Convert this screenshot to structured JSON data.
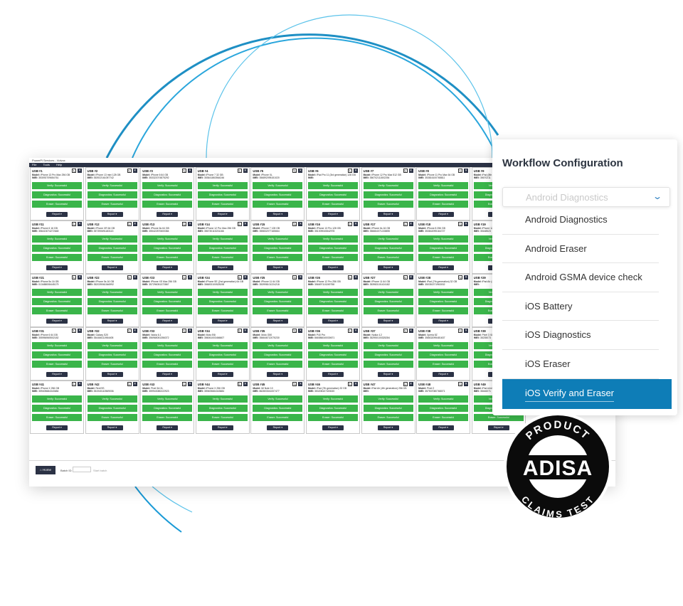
{
  "window": {
    "title": "PowerPi Services - Volvox",
    "menu": [
      "File",
      "Tools",
      "Help"
    ]
  },
  "labels": {
    "model": "Model:",
    "imei": "IMEI:",
    "verify": "Verify: Successful",
    "diagnostics": "Diagnostics: Successful",
    "eraser": "Eraser: Successful",
    "report": "Report ▾"
  },
  "cells": [
    {
      "usb": "USB #1",
      "model": "iPhone 13 Pro Max 256 GB",
      "imei": "353092709654761",
      "buttons": 3
    },
    {
      "usb": "USB #2",
      "model": "iPhone 13 mini 128 GB",
      "imei": "353922161057742",
      "buttons": 3
    },
    {
      "usb": "USB #3",
      "model": "iPhone 6 64 GB",
      "imei": "353322074875292",
      "buttons": 3
    },
    {
      "usb": "USB #4",
      "model": "iPhone 7 32 GB",
      "imei": "353641863564246",
      "buttons": 3
    },
    {
      "usb": "USB #5",
      "model": "iPhone XL",
      "imei": "356892095151020",
      "buttons": 3
    },
    {
      "usb": "USB #6",
      "model": "iPad Pro 11 (3rd generation) 128 GB",
      "imei": "",
      "buttons": 3
    },
    {
      "usb": "USB #7",
      "model": "iPhone 12 Pro Max 512 GB",
      "imei": "356702111502254",
      "buttons": 3
    },
    {
      "usb": "USB #8",
      "model": "iPhone 11 Pro Max 64 GB",
      "imei": "353816100768811",
      "buttons": 3
    },
    {
      "usb": "USB #9",
      "model": "iPad (8th",
      "imei": "35670211",
      "buttons": 3
    },
    {
      "usb": "USB #11",
      "model": "iPhone 6 16 GB",
      "imei": "356413074272648",
      "buttons": 3
    },
    {
      "usb": "USB #12",
      "model": "iPhone XR 64 GB",
      "imei": "357390691183113",
      "buttons": 3
    },
    {
      "usb": "USB #13",
      "model": "iPhone 6s 64 GB",
      "imei": "355422870600384",
      "buttons": 3
    },
    {
      "usb": "USB #14",
      "model": "iPhone 12 Pro Max 256 GB",
      "imei": "356730115231166",
      "buttons": 3
    },
    {
      "usb": "USB #15",
      "model": "iPhone 7 128 GB",
      "imei": "355832077165664",
      "buttons": 3
    },
    {
      "usb": "USB #16",
      "model": "iPhone 13 Pro 128 GB",
      "imei": "351009040842978",
      "buttons": 3
    },
    {
      "usb": "USB #17",
      "model": "iPhone 6s 16 GB",
      "imei": "356664071215855",
      "buttons": 3
    },
    {
      "usb": "USB #18",
      "model": "iPhone 8 256 GB",
      "imei": "353842095164727",
      "buttons": 3
    },
    {
      "usb": "USB #19",
      "model": "iPhone 12",
      "imei": "35168523",
      "buttons": 3
    },
    {
      "usb": "USB #21",
      "model": "iPhone 5s 16 GB",
      "imei": "013488008445179",
      "buttons": 3
    },
    {
      "usb": "USB #22",
      "model": "iPhone 5s 16 GB",
      "imei": "352039061546992",
      "buttons": 3
    },
    {
      "usb": "USB #23",
      "model": "iPhone XS Max 256 GB",
      "imei": "357296051372867",
      "buttons": 3
    },
    {
      "usb": "USB #24",
      "model": "iPhone SE (2nd generation) 64 GB",
      "imei": "356693100528198",
      "buttons": 3
    },
    {
      "usb": "USB #25",
      "model": "iPhone 11 64 GB",
      "imei": "353998101224218",
      "buttons": 3
    },
    {
      "usb": "USB #26",
      "model": "iPhone 12 Pro 256 GB",
      "imei": "356697110249758",
      "buttons": 3
    },
    {
      "usb": "USB #27",
      "model": "iPhone 11 64 GB",
      "imei": "353983101424182",
      "buttons": 3
    },
    {
      "usb": "USB #28",
      "model": "iPad (7th generation) 32 GB",
      "imei": "350351371963032",
      "buttons": 3
    },
    {
      "usb": "USB #29",
      "model": "iPad Air (4",
      "imei": "",
      "buttons": 3
    },
    {
      "usb": "USB #31",
      "model": "iPhone 6 64 GB",
      "imei": "355956965502182",
      "buttons": 3
    },
    {
      "usb": "USB #32",
      "model": "Galaxy S20",
      "imei": "354466111984405",
      "buttons": 3
    },
    {
      "usb": "USB #33",
      "model": "Nokia 6.1",
      "imei": "356968051356372",
      "buttons": 3
    },
    {
      "usb": "USB #34",
      "model": "Moto E6i",
      "imei": "356061003466607",
      "buttons": 3
    },
    {
      "usb": "USB #35",
      "model": "Moto G50",
      "imei": "356646712075230",
      "buttons": 3
    },
    {
      "usb": "USB #36",
      "model": "P40 Pro",
      "imei": "866586040030671",
      "buttons": 3
    },
    {
      "usb": "USB #37",
      "model": "Nokia 4.2",
      "imei": "352950100325284",
      "buttons": 3
    },
    {
      "usb": "USB #38",
      "model": "Xperia 5Z",
      "imei": "358632095481637",
      "buttons": 3
    },
    {
      "usb": "USB #39",
      "model": "Pixel 3 XL",
      "imei": "35235073",
      "buttons": 3
    },
    {
      "usb": "USB #41",
      "model": "iPhone X 256 GB",
      "imei": "359405684343684",
      "buttons": 3
    },
    {
      "usb": "USB #42",
      "model": "Redi 9S",
      "imei": "351940110569006",
      "buttons": 3
    },
    {
      "usb": "USB #43",
      "model": "Pixel 3A XL",
      "imei": "359943080222923",
      "buttons": 3
    },
    {
      "usb": "USB #44",
      "model": "iPhone X 256 GB",
      "imei": "359405684343684",
      "buttons": 3
    },
    {
      "usb": "USB #45",
      "model": "Mi Note 10",
      "imei": "862803041007477",
      "buttons": 3
    },
    {
      "usb": "USB #46",
      "model": "iPad (7th generation) 32 GB",
      "imei": "353208107403020",
      "buttons": 3
    },
    {
      "usb": "USB #47",
      "model": "iPad Air (4th generation) 256 GB",
      "imei": "",
      "buttons": 3
    },
    {
      "usb": "USB #48",
      "model": "Pixel 2",
      "imei": "357537080768071",
      "buttons": 3
    },
    {
      "usb": "USB #49",
      "model": "iPad mini",
      "imei": "35446071",
      "buttons": 3
    }
  ],
  "footer": {
    "home": "Home",
    "batch_label": "Batch ID:",
    "batch_hint": "Start batch"
  },
  "workflow": {
    "title": "Workflow Configuration",
    "selected_placeholder": "Android Diagnostics",
    "options": [
      "Android Diagnostics",
      "Android Eraser",
      "Android GSMA device check",
      "iOS Battery",
      "iOS Diagnostics",
      "iOS Eraser",
      "iOS Verify and Eraser"
    ],
    "highlighted_index": 6
  },
  "badge": {
    "top": "PRODUCT",
    "middle": "ADISA",
    "bottom": "CLAIMS TEST"
  },
  "colors": {
    "success_green": "#3ab54a",
    "navy": "#2b3245",
    "accent_blue": "#0e7db7",
    "arc_blue": "#1a9ad6"
  }
}
